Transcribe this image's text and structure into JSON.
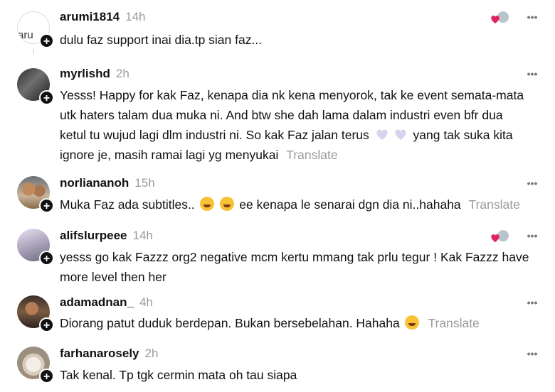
{
  "comments": [
    {
      "username": "arumi1814",
      "time": "14h",
      "text": "dulu faz support inai dia.tp sian faz...",
      "avatar_alt": "aru",
      "has_translate": false,
      "liked_by_author": true
    },
    {
      "username": "myrlishd",
      "time": "2h",
      "text_before": "Yesss! Happy for kak Faz, kenapa dia nk kena menyorok, tak ke event semata-mata utk haters talam dua muka ni. And btw she dah lama dalam industri even bfr dua ketul tu wujud lagi dlm industri ni. So kak Faz jalan terus",
      "emoji": [
        "purple-heart-icon",
        "purple-heart-icon"
      ],
      "text_after": "yang tak suka kita ignore je, masih ramai lagi yg menyukai",
      "translate_label": "Translate"
    },
    {
      "username": "norliananoh",
      "time": "15h",
      "text_before": "Muka Faz ada subtitles..",
      "emoji": [
        "sweat-smile-icon",
        "sweat-smile-icon"
      ],
      "text_after": "ee kenapa le senarai dgn dia ni..hahaha",
      "translate_label": "Translate"
    },
    {
      "username": "alifslurpeee",
      "time": "14h",
      "text": "yesss go kak Fazzz org2 negative mcm kertu mmang tak prlu tegur ! Kak Fazzz have more level then her",
      "liked_by_author": true
    },
    {
      "username": "adamadnan_",
      "time": "4h",
      "text_before": "Diorang patut duduk berdepan. Bukan bersebelahan. Hahaha",
      "emoji": [
        "laughing-icon"
      ],
      "translate_label": "Translate"
    },
    {
      "username": "farhanarosely",
      "time": "2h",
      "text": "Tak kenal. Tp tgk cermin mata oh tau siapa"
    }
  ],
  "more_label": "•••",
  "follow_label": "+"
}
